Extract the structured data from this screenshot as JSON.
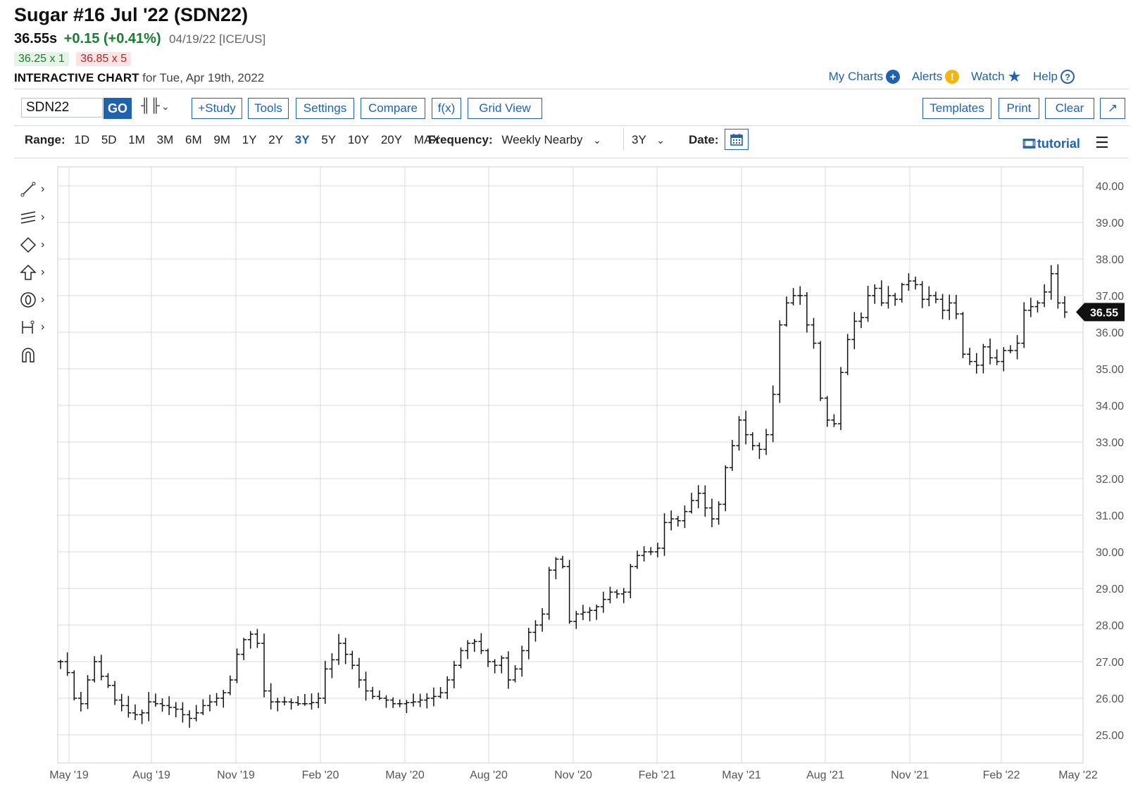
{
  "header": {
    "title": "Sugar #16 Jul '22 (SDN22)",
    "last": "36.55s",
    "change": "+0.15 (+0.41%)",
    "date_exchange": "04/19/22 [ICE/US]",
    "bid": "36.25 x 1",
    "ask": "36.85 x 5",
    "interactive_label": "INTERACTIVE CHART",
    "interactive_date": "for Tue, Apr 19th, 2022"
  },
  "top_links": {
    "my_charts": "My Charts",
    "alerts": "Alerts",
    "watch": "Watch",
    "help": "Help"
  },
  "toolbar": {
    "symbol": "SDN22",
    "go": "GO",
    "study": "+Study",
    "tools": "Tools",
    "settings": "Settings",
    "compare": "Compare",
    "fx": "f(x)",
    "grid_view": "Grid View",
    "templates": "Templates",
    "print": "Print",
    "clear": "Clear",
    "expand": "↗"
  },
  "range_bar": {
    "range_label": "Range:",
    "ranges": [
      "1D",
      "5D",
      "1M",
      "3M",
      "6M",
      "9M",
      "1Y",
      "2Y",
      "3Y",
      "5Y",
      "10Y",
      "20Y",
      "MAX"
    ],
    "active_range": "3Y",
    "frequency_label": "Frequency:",
    "frequency": "Weekly Nearby",
    "period": "3Y",
    "date_label": "Date:",
    "tutorial": "tutorial"
  },
  "left_tools": [
    "line-tool-icon",
    "multi-line-tool-icon",
    "shape-tool-icon",
    "arrow-tool-icon",
    "text-tool-icon",
    "measure-tool-icon",
    "magnet-icon"
  ],
  "colors": {
    "accent": "#1f62b0",
    "bar": "#111111",
    "grid": "#d9d9d9",
    "up": "#1b7d33",
    "ask": "#b12525"
  },
  "chart_data": {
    "type": "bar",
    "style": "ohlc",
    "frequency": "weekly",
    "last_price_label": "36.55",
    "ylim": [
      24.3,
      40.6
    ],
    "y_ticks": [
      "25.00",
      "26.00",
      "27.00",
      "28.00",
      "29.00",
      "30.00",
      "31.00",
      "32.00",
      "33.00",
      "34.00",
      "35.00",
      "36.00",
      "37.00",
      "38.00",
      "39.00",
      "40.00"
    ],
    "x_ticks": [
      "May '19",
      "Aug '19",
      "Nov '19",
      "Feb '20",
      "May '20",
      "Aug '20",
      "Nov '20",
      "Feb '21",
      "May '21",
      "Aug '21",
      "Nov '21",
      "Feb '22",
      "May '22"
    ],
    "grid": true,
    "closes": [
      27.0,
      26.7,
      26.0,
      25.85,
      26.5,
      27.0,
      26.6,
      26.35,
      25.95,
      25.8,
      25.6,
      25.55,
      25.6,
      25.9,
      25.85,
      25.8,
      25.75,
      25.7,
      25.55,
      25.45,
      25.6,
      25.8,
      25.9,
      26.0,
      26.15,
      26.5,
      27.2,
      27.6,
      27.75,
      27.5,
      26.2,
      25.9,
      25.9,
      25.9,
      25.88,
      25.85,
      25.85,
      25.88,
      26.0,
      26.8,
      27.05,
      27.5,
      27.2,
      26.9,
      26.5,
      26.2,
      26.05,
      26.0,
      25.95,
      25.85,
      25.85,
      25.88,
      25.9,
      25.95,
      26.0,
      26.05,
      26.15,
      26.5,
      26.9,
      27.3,
      27.5,
      27.55,
      27.3,
      27.0,
      26.9,
      27.1,
      26.5,
      26.8,
      27.3,
      27.8,
      28.0,
      28.3,
      29.5,
      29.8,
      29.6,
      28.1,
      28.3,
      28.35,
      28.4,
      28.5,
      28.7,
      28.9,
      28.85,
      28.9,
      29.6,
      29.9,
      30.0,
      30.0,
      30.1,
      30.8,
      30.9,
      30.85,
      31.1,
      31.4,
      31.6,
      31.2,
      30.9,
      31.3,
      32.3,
      32.9,
      33.6,
      33.2,
      32.9,
      32.8,
      33.2,
      34.3,
      36.2,
      36.8,
      37.0,
      37.0,
      36.2,
      35.7,
      34.2,
      33.6,
      33.5,
      34.9,
      35.8,
      36.3,
      36.4,
      37.0,
      37.2,
      36.8,
      37.0,
      36.9,
      37.3,
      37.4,
      37.3,
      36.9,
      37.0,
      36.9,
      36.6,
      36.8,
      36.5,
      35.4,
      35.2,
      35.1,
      35.6,
      35.3,
      35.2,
      35.5,
      35.5,
      35.7,
      36.6,
      36.7,
      36.8,
      37.1,
      37.6,
      36.8,
      36.55
    ]
  }
}
